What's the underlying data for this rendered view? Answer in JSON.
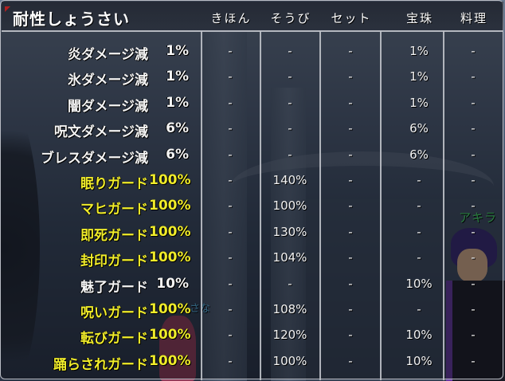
{
  "window": {
    "title": "耐性しょうさい",
    "columns": [
      "きほん",
      "そうび",
      "セット",
      "宝珠",
      "料理"
    ]
  },
  "overlay": {
    "player_name": "アキラ",
    "other_name": "さな"
  },
  "colors": {
    "normal_text": "#f4f4f4",
    "guard_text": "#f0ec2a",
    "player_name": "#48e86a"
  },
  "rows": [
    {
      "name": "炎ダメージ減",
      "total": "1%",
      "kihon": "-",
      "soubi": "-",
      "set": "-",
      "houju": "1%",
      "ryouri": "-",
      "color": "white"
    },
    {
      "name": "氷ダメージ減",
      "total": "1%",
      "kihon": "-",
      "soubi": "-",
      "set": "-",
      "houju": "1%",
      "ryouri": "-",
      "color": "white"
    },
    {
      "name": "闇ダメージ減",
      "total": "1%",
      "kihon": "-",
      "soubi": "-",
      "set": "-",
      "houju": "1%",
      "ryouri": "-",
      "color": "white"
    },
    {
      "name": "呪文ダメージ減",
      "total": "6%",
      "kihon": "-",
      "soubi": "-",
      "set": "-",
      "houju": "6%",
      "ryouri": "-",
      "color": "white"
    },
    {
      "name": "ブレスダメージ減",
      "total": "6%",
      "kihon": "-",
      "soubi": "-",
      "set": "-",
      "houju": "6%",
      "ryouri": "-",
      "color": "white"
    },
    {
      "name": "眠りガード",
      "total": "100%",
      "kihon": "-",
      "soubi": "140%",
      "set": "-",
      "houju": "-",
      "ryouri": "-",
      "color": "yellow"
    },
    {
      "name": "マヒガード",
      "total": "100%",
      "kihon": "-",
      "soubi": "100%",
      "set": "-",
      "houju": "-",
      "ryouri": "-",
      "color": "yellow"
    },
    {
      "name": "即死ガード",
      "total": "100%",
      "kihon": "-",
      "soubi": "130%",
      "set": "-",
      "houju": "-",
      "ryouri": "-",
      "color": "yellow"
    },
    {
      "name": "封印ガード",
      "total": "100%",
      "kihon": "-",
      "soubi": "104%",
      "set": "-",
      "houju": "-",
      "ryouri": "-",
      "color": "yellow"
    },
    {
      "name": "魅了ガード",
      "total": "10%",
      "kihon": "-",
      "soubi": "-",
      "set": "-",
      "houju": "10%",
      "ryouri": "-",
      "color": "white"
    },
    {
      "name": "呪いガード",
      "total": "100%",
      "kihon": "-",
      "soubi": "108%",
      "set": "-",
      "houju": "-",
      "ryouri": "-",
      "color": "yellow"
    },
    {
      "name": "転びガード",
      "total": "100%",
      "kihon": "-",
      "soubi": "120%",
      "set": "-",
      "houju": "10%",
      "ryouri": "-",
      "color": "yellow"
    },
    {
      "name": "踊らされガード",
      "total": "100%",
      "kihon": "-",
      "soubi": "100%",
      "set": "-",
      "houju": "10%",
      "ryouri": "-",
      "color": "yellow"
    }
  ]
}
